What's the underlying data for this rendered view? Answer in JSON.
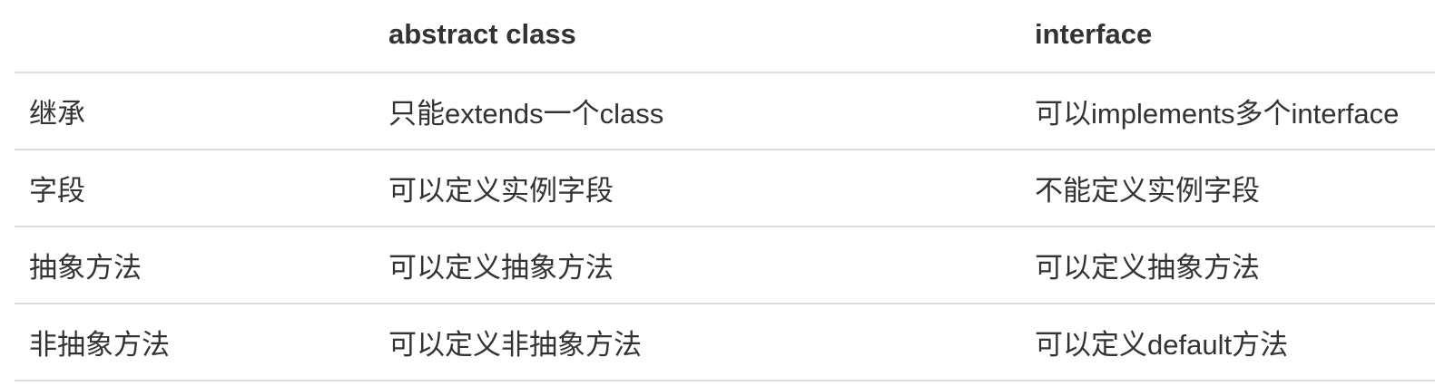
{
  "table": {
    "headers": [
      "",
      "abstract class",
      "interface"
    ],
    "rows": [
      [
        "继承",
        "只能extends一个class",
        "可以implements多个interface"
      ],
      [
        "字段",
        "可以定义实例字段",
        "不能定义实例字段"
      ],
      [
        "抽象方法",
        "可以定义抽象方法",
        "可以定义抽象方法"
      ],
      [
        "非抽象方法",
        "可以定义非抽象方法",
        "可以定义default方法"
      ]
    ]
  }
}
